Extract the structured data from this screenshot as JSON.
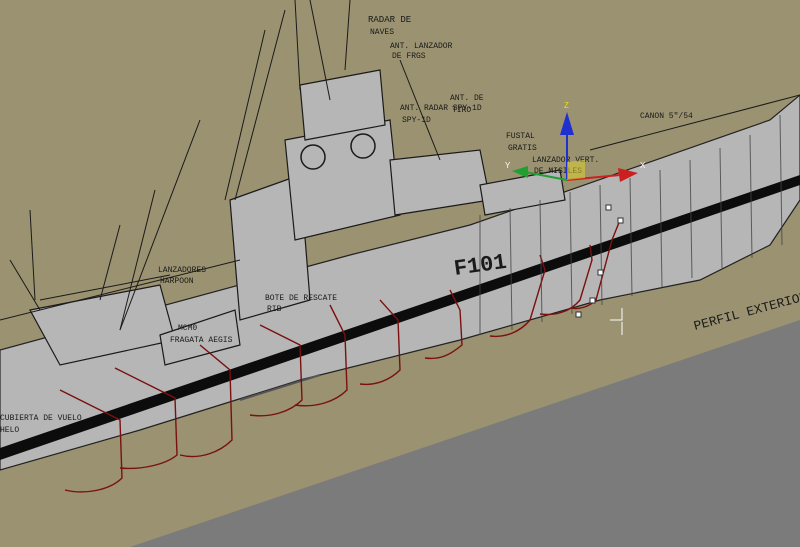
{
  "viewport": {
    "name": "3d-perspective-viewport",
    "colors": {
      "background": "#9a9270",
      "ground": "#7b7b7b",
      "hull": "#b4b4b4",
      "spline": "#7a1010",
      "boot_stripe": "#0c0c0c"
    }
  },
  "blueprint": {
    "hull_number": "F101",
    "labels": {
      "radar_top": "RADAR DE",
      "radar_top_sub": "NAVES",
      "antenna": "ANT. LANZADOR",
      "antenna_sub": "DE FRGS",
      "radar_spy": "ANT. RADAR SPY-1D",
      "spy_sub": "SPY-1D",
      "antena2": "ANT. DE",
      "antena2_sub": "TIRO",
      "fustal": "FUSTAL",
      "fustal_sub": "GRATIS",
      "lanzador": "LANZADOR VERT.",
      "lanzador_sub": "DE MISILES",
      "canon": "CANON 5\"/54",
      "harpoon": "LANZADORES",
      "harpoon_sub": "HARPOON",
      "bote": "BOTE DE RESCATE",
      "bote_sub": "RIB",
      "perfil": "PERFIL EXTERIOR",
      "mid_label": "MCM0",
      "mid_label_sub": "FRAGATA AEGIS",
      "aft_label": "CUBIERTA DE VUELO",
      "aft_label_sub": "HELO"
    }
  },
  "gizmo": {
    "name": "move-transform-gizmo",
    "axes": [
      {
        "axis": "Z",
        "color": "#2030d0"
      },
      {
        "axis": "X",
        "color": "#cc2020"
      },
      {
        "axis": "Y",
        "color": "#20a030"
      }
    ]
  }
}
